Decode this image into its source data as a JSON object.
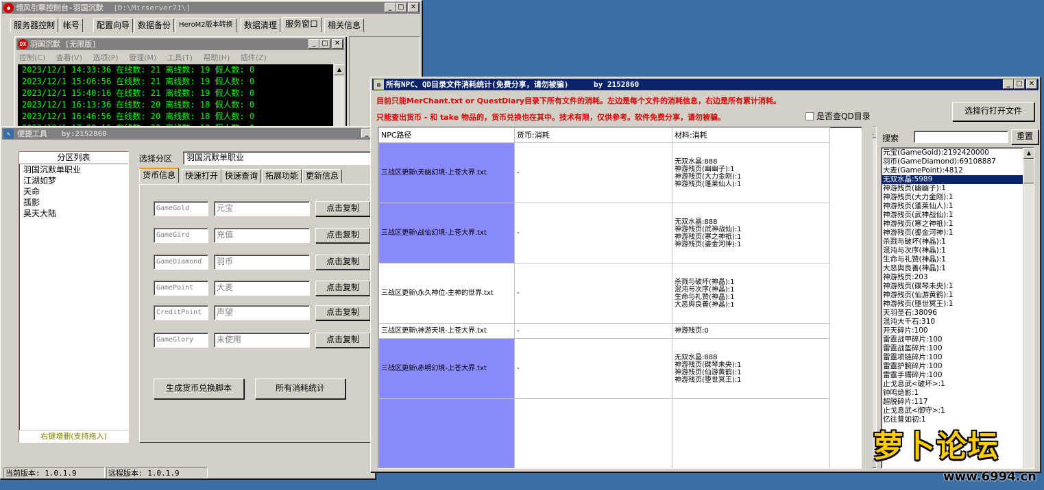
{
  "main_window": {
    "title": "翎风引擎控制台-羽国沉默",
    "path": "[D:\\Mirserver71\\]",
    "tabs": [
      "服务器控制",
      "帐号",
      "配置向导",
      "数据备份",
      "HeroM2版本转换",
      "数据清理",
      "服务窗口",
      "相关信息"
    ],
    "selected_tab": "服务窗口"
  },
  "server_window": {
    "title": "羽国沉默 [无限版]",
    "menu": [
      "控制(C)",
      "查看(V)",
      "选项(P)",
      "管理(M)",
      "工具(T)",
      "帮助(H)",
      "插件(Z)"
    ],
    "log_lines": [
      "2023/12/1 14:33:36 在线数: 21 离线数: 19 假人数: 0",
      "2023/12/1 15:06:56 在线数: 21 离线数: 19 假人数: 0",
      "2023/12/1 15:40:16 在线数: 21 离线数: 19 假人数: 0",
      "2023/12/1 16:13:36 在线数: 20 离线数: 18 假人数: 0",
      "2023/12/1 16:46:56 在线数: 20 离线数: 18 假人数: 0",
      "2023/12/1 17:20:16 在线数: 20 离线数: 18 假人数: 0"
    ]
  },
  "tools_window": {
    "title": "便捷工具",
    "author": "by:2152860",
    "zone_list_header": "分区列表",
    "zones": [
      "羽国沉默单职业",
      "江湖如梦",
      "天命",
      "孤影",
      "昊天大陆"
    ],
    "zone_footer": "右键增删(支持拖入)",
    "select_zone_label": "选择分区",
    "selected_zone": "羽国沉默单职业",
    "tabs": [
      "货币信息",
      "快速打开",
      "快速查询",
      "拓展功能",
      "更新信息"
    ],
    "selected_tab": "货币信息",
    "currency_rows": [
      {
        "code": "GameGold",
        "name": "元宝",
        "button": "点击复制"
      },
      {
        "code": "GameGird",
        "name": "充值",
        "button": "点击复制"
      },
      {
        "code": "GameDiamond",
        "name": "羽币",
        "button": "点击复制"
      },
      {
        "code": "GamePoint",
        "name": "大麦",
        "button": "点击复制"
      },
      {
        "code": "CreditPoint",
        "name": "声望",
        "button": "点击复制"
      },
      {
        "code": "GameGlory",
        "name": "未使用",
        "button": "点击复制"
      }
    ],
    "gen_script_button": "生成货币兑换脚本",
    "all_stats_button": "所有消耗统计",
    "status_local": "当前版本: 1.0.1.9",
    "status_remote": "远程版本: 1.0.1.9"
  },
  "stats_window": {
    "title": "所有NPC、QD目录文件消耗统计(免费分享，请勿被骗)",
    "author": "by 2152860",
    "note1": "目前只能MerChant.txt or QuestDiary目录下所有文件的消耗。左边是每个文件的消耗信息，右边是所有累计消耗。",
    "note2": "只能查出货币 - 和 take 物品的，货币兑换也在其中。技术有限，仅供参考。软件免费分享，请勿被骗。",
    "qd_checkbox": "是否查QD目录",
    "open_file_button": "选择行打开文件",
    "search_label": "搜索",
    "search_value": "",
    "reset_button": "重置",
    "columns": [
      "NPC路径",
      "货币:消耗",
      "材料:消耗"
    ],
    "rows": [
      {
        "path": "三战区更新\\天幽幻境-上苍大界.txt",
        "currency": "-",
        "materials": [
          "无双水晶:888",
          "神游残页(幽幽子):1",
          "神游残页(大力金刚):1",
          "神游残页(蓬莱仙人):1"
        ],
        "highlight": true
      },
      {
        "path": "三战区更新\\战仙幻境-上苍大界.txt",
        "currency": "-",
        "materials": [
          "无双水晶:888",
          "神游残页(武神战仙):1",
          "神游残页(寒之神祇):1",
          "神游残页(鎏金河神):1"
        ],
        "highlight": true
      },
      {
        "path": "三战区更新\\永久神位-主神的世界.txt",
        "currency": "-",
        "materials": [
          "杀戮与破坏(神晶):1",
          "混沌与次序(神晶):1",
          "生命与礼赞(神晶):1",
          "大恶與良善(神晶):1"
        ],
        "highlight": false
      },
      {
        "path": "三战区更新\\神游天境-上苍大界.txt",
        "currency": "-",
        "materials": [
          "神游残页:0"
        ],
        "highlight": false
      },
      {
        "path": "三战区更新\\赤明幻境-上苍大界.txt",
        "currency": "-",
        "materials": [
          "无双水晶:888",
          "神游残页(碟琴未央):1",
          "神游残页(仙游黄鹤):1",
          "神游残页(堕世冥王):1"
        ],
        "highlight": true
      },
      {
        "path": "",
        "currency": "",
        "materials": [],
        "highlight": true
      }
    ],
    "totals": [
      "元宝(GameGold):2192420000",
      "羽币(GameDiamond):69108887",
      "大麦(GamePoint):4812",
      "无双水晶:5989",
      "神游残页(幽幽子):1",
      "神游残页(大力金刚):1",
      "神游残页(蓬莱仙人):1",
      "神游残页(武神战仙):1",
      "神游残页(寒之神祇):1",
      "神游残页(鎏金河神):1",
      "杀戮与破坏(神晶):1",
      "混沌与次序(神晶):1",
      "生命与礼赞(神晶):1",
      "大恶與良善(神晶):1",
      "神游残页:203",
      "神游残页(碟琴未央):1",
      "神游残页(仙游黄鹤):1",
      "神游残页(堕世冥王):1",
      "天羽圣石:38096",
      "混沌大千石:310",
      "开天碎片:100",
      "雷霆战甲碎片:100",
      "雷霆战盔碎片:100",
      "雷霆项链碎片:100",
      "雷霆护腕碎片:100",
      "雷霆手镯碎片:100",
      "止戈息武<破坏>:1",
      "钟鸣绝影:1",
      "超脱碎片:117",
      "止戈息武<御守>:1",
      "忆往昔如初:1"
    ],
    "selected_total": "无双水晶:5989"
  },
  "watermark": {
    "text": "萝卜论坛",
    "url": "www.6994.cn"
  },
  "colors": {
    "highlight_cell": "#8a8aff",
    "title_active": "#0a246a",
    "note_red": "#e00000",
    "console_green": "#00ff00"
  }
}
